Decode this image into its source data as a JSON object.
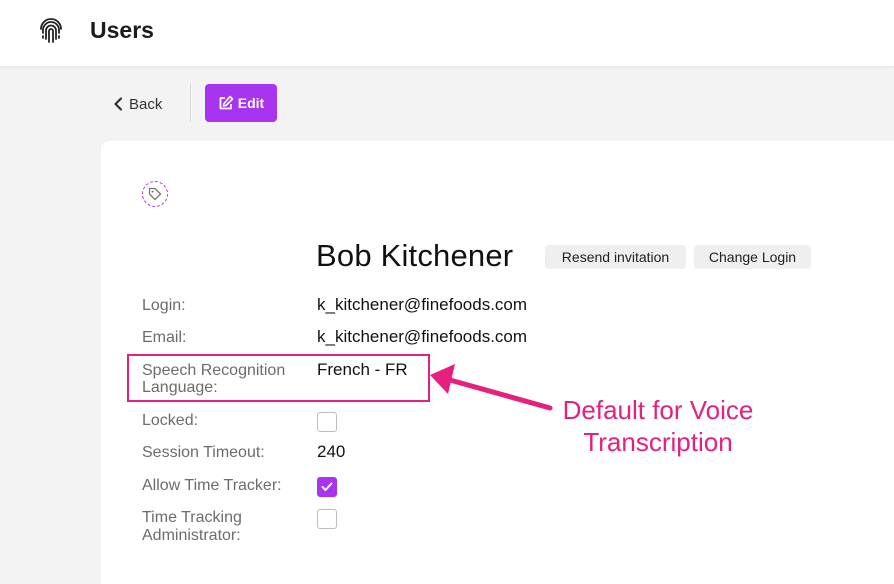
{
  "header": {
    "title": "Users",
    "logo_icon": "fingerprint-icon"
  },
  "toolbar": {
    "back_label": "Back",
    "edit_label": "Edit"
  },
  "user": {
    "name": "Bob Kitchener",
    "actions": {
      "resend_invitation": "Resend invitation",
      "change_login": "Change Login"
    }
  },
  "fields": {
    "login": {
      "label": "Login:",
      "value": "k_kitchener@finefoods.com"
    },
    "email": {
      "label": "Email:",
      "value": "k_kitchener@finefoods.com"
    },
    "speech_language": {
      "label_line1": "Speech Recognition",
      "label_line2": "Language:",
      "value": "French - FR"
    },
    "locked": {
      "label": "Locked:",
      "checked": false
    },
    "session_timeout": {
      "label": "Session Timeout:",
      "value": "240"
    },
    "allow_time_tracker": {
      "label": "Allow Time Tracker:",
      "checked": true
    },
    "time_tracking_admin": {
      "label_line1": "Time Tracking",
      "label_line2": "Administrator:",
      "checked": false
    }
  },
  "annotation": {
    "line1": "Default for Voice",
    "line2": "Transcription"
  },
  "colors": {
    "accent": "#a834f0",
    "annotation": "#e6207e"
  }
}
